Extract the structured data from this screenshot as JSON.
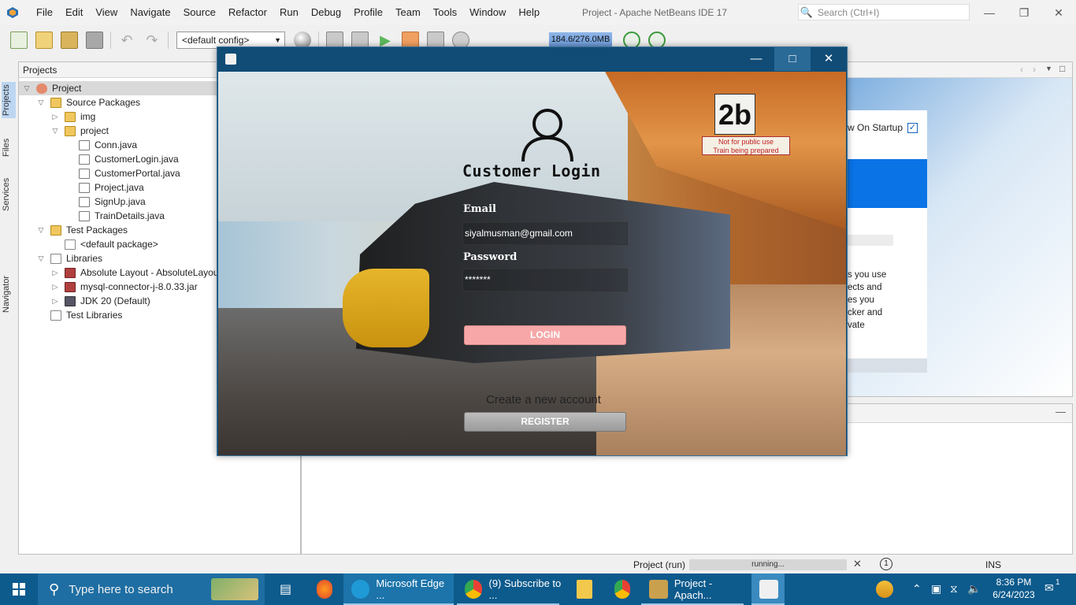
{
  "ide": {
    "title": "Project - Apache NetBeans IDE 17",
    "menu": [
      "File",
      "Edit",
      "View",
      "Navigate",
      "Source",
      "Refactor",
      "Run",
      "Debug",
      "Profile",
      "Team",
      "Tools",
      "Window",
      "Help"
    ],
    "search_placeholder": "Search (Ctrl+I)",
    "config": "<default config>",
    "memory": "184.6/276.0MB"
  },
  "side_tabs": [
    "Projects",
    "Files",
    "Services",
    "Navigator"
  ],
  "projects_panel": {
    "title": "Projects",
    "tree": [
      {
        "label": "Project",
        "level": 0,
        "toggle": "▽",
        "icon": "ic-proj",
        "selected": true
      },
      {
        "label": "Source Packages",
        "level": 1,
        "toggle": "▽",
        "icon": "ic-pkg"
      },
      {
        "label": "img",
        "level": 2,
        "toggle": "▷",
        "icon": "ic-pkg"
      },
      {
        "label": "project",
        "level": 2,
        "toggle": "▽",
        "icon": "ic-pkg"
      },
      {
        "label": "Conn.java",
        "level": 3,
        "toggle": "",
        "icon": "ic-java"
      },
      {
        "label": "CustomerLogin.java",
        "level": 3,
        "toggle": "",
        "icon": "ic-java"
      },
      {
        "label": "CustomerPortal.java",
        "level": 3,
        "toggle": "",
        "icon": "ic-java"
      },
      {
        "label": "Project.java",
        "level": 3,
        "toggle": "",
        "icon": "ic-java"
      },
      {
        "label": "SignUp.java",
        "level": 3,
        "toggle": "",
        "icon": "ic-java"
      },
      {
        "label": "TrainDetails.java",
        "level": 3,
        "toggle": "",
        "icon": "ic-java"
      },
      {
        "label": "Test Packages",
        "level": 1,
        "toggle": "▽",
        "icon": "ic-pkg"
      },
      {
        "label": "<default package>",
        "level": 2,
        "toggle": "",
        "icon": "ic-lib"
      },
      {
        "label": "Libraries",
        "level": 1,
        "toggle": "▽",
        "icon": "ic-lib"
      },
      {
        "label": "Absolute Layout - AbsoluteLayou",
        "level": 2,
        "toggle": "▷",
        "icon": "ic-jar"
      },
      {
        "label": "mysql-connector-j-8.0.33.jar",
        "level": 2,
        "toggle": "▷",
        "icon": "ic-jar"
      },
      {
        "label": "JDK 20 (Default)",
        "level": 2,
        "toggle": "▷",
        "icon": "ic-jdk"
      },
      {
        "label": "Test Libraries",
        "level": 1,
        "toggle": "",
        "icon": "ic-lib"
      }
    ]
  },
  "welcome": {
    "show_on_startup": "w On Startup",
    "text_lines": [
      "s you use",
      "ects and",
      "es you",
      "cker and",
      "vate"
    ]
  },
  "status": {
    "run_label": "Project (run)",
    "progress_text": "running...",
    "insert_mode": "INS",
    "notifications": "1"
  },
  "login": {
    "heading": "Customer Login",
    "email_label": "Email",
    "email_value": "siyalmusman@gmail.com",
    "password_label": "Password",
    "password_value": "*******",
    "login_button": "LOGIN",
    "create_account_text": "Create a new account",
    "register_button": "REGISTER",
    "scene_sign_number": "2b",
    "scene_sign_text": "Not for public use\nTrain being prepared"
  },
  "taskbar": {
    "search_placeholder": "Type here to search",
    "apps": [
      {
        "label": "Microsoft Edge ...",
        "color": "#1f9ad6"
      },
      {
        "label": "(9) Subscribe to ...",
        "color": "#e94235"
      },
      {
        "label": "Project - Apach...",
        "color": "#c9a04e"
      }
    ],
    "time": "8:36 PM",
    "date": "6/24/2023",
    "notification_count": "1"
  }
}
